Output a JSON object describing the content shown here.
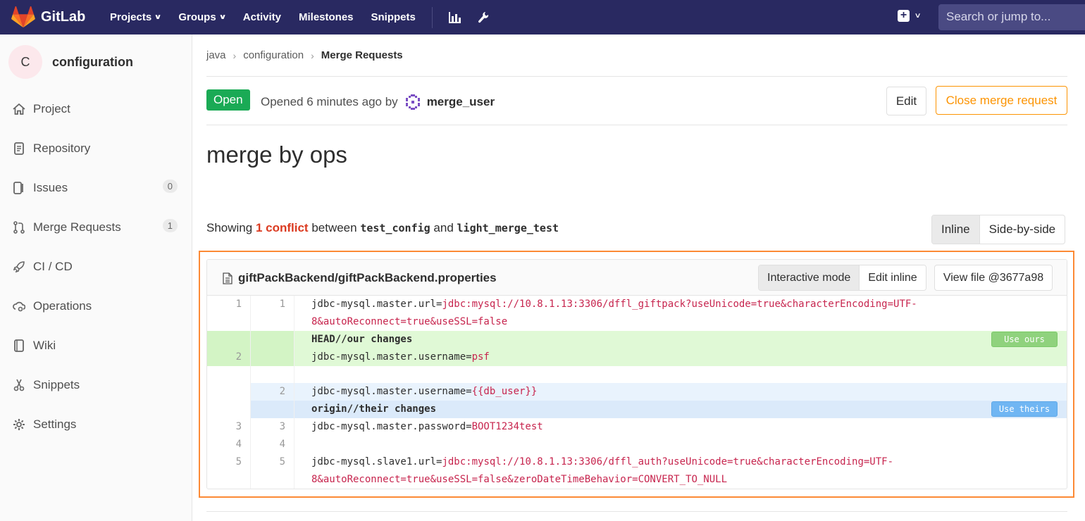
{
  "topnav": {
    "brand": "GitLab",
    "items": [
      "Projects",
      "Groups",
      "Activity",
      "Milestones",
      "Snippets"
    ],
    "search_placeholder": "Search or jump to..."
  },
  "sidebar": {
    "project_initial": "C",
    "project_name": "configuration",
    "items": [
      {
        "label": "Project",
        "icon": "home-icon"
      },
      {
        "label": "Repository",
        "icon": "repository-icon"
      },
      {
        "label": "Issues",
        "icon": "issues-icon",
        "badge": "0"
      },
      {
        "label": "Merge Requests",
        "icon": "merge-request-icon",
        "badge": "1"
      },
      {
        "label": "CI / CD",
        "icon": "rocket-icon"
      },
      {
        "label": "Operations",
        "icon": "cloud-gear-icon"
      },
      {
        "label": "Wiki",
        "icon": "book-icon"
      },
      {
        "label": "Snippets",
        "icon": "scissors-icon"
      },
      {
        "label": "Settings",
        "icon": "gear-icon"
      }
    ]
  },
  "breadcrumb": {
    "items": [
      "java",
      "configuration"
    ],
    "current": "Merge Requests"
  },
  "mr": {
    "status": "Open",
    "opened_text": "Opened 6 minutes ago by",
    "author": "merge_user",
    "edit_label": "Edit",
    "close_label": "Close merge request",
    "title": "merge by ops"
  },
  "conflicts": {
    "showing": "Showing",
    "count": "1 conflict",
    "between": "between",
    "source": "test_config",
    "and": "and",
    "target": "light_merge_test",
    "view_inline": "Inline",
    "view_side": "Side-by-side"
  },
  "file": {
    "name": "giftPackBackend/giftPackBackend.properties",
    "interactive_label": "Interactive mode",
    "edit_inline_label": "Edit inline",
    "view_file_label": "View file @3677a98",
    "use_ours": "Use ours",
    "use_theirs": "Use theirs",
    "lines": {
      "l1_key": "jdbc-mysql.master.url=",
      "l1_val": "jdbc:mysql://10.8.1.13:3306/dffl_giftpack?useUnicode=true&characterEncoding=UTF-",
      "l1_cont": "8&autoReconnect=true&useSSL=false",
      "ours_header": "HEAD//our changes",
      "ours_key": "jdbc-mysql.master.username=",
      "ours_val": "psf",
      "theirs_key": "jdbc-mysql.master.username=",
      "theirs_val": "{{db_user}}",
      "theirs_header": "origin//their changes",
      "l3_key": "jdbc-mysql.master.password=",
      "l3_val": "BOOT1234test",
      "l5_key": "jdbc-mysql.slave1.url=",
      "l5_val": "jdbc:mysql://10.8.1.13:3306/dffl_auth?useUnicode=true&characterEncoding=UTF-",
      "l5_cont": "8&autoReconnect=true&useSSL=false&zeroDateTimeBehavior=CONVERT_TO_NULL"
    },
    "line_numbers": {
      "n1": "1",
      "n2": "2",
      "n3": "3",
      "n4": "4",
      "n5": "5"
    }
  }
}
